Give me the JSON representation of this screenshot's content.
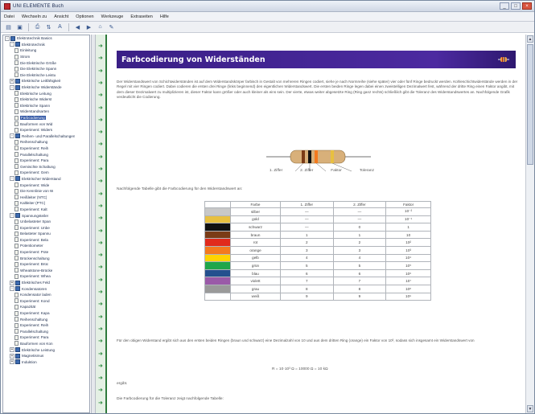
{
  "window": {
    "title": "UNI ELEMENTE Buch"
  },
  "menu": [
    "Datei",
    "Wechseln zu",
    "Ansicht",
    "Optionen",
    "Werkzeuge",
    "Extraseiten",
    "Hilfe"
  ],
  "toolbar": {
    "buttons": [
      "hide-icon",
      "save-icon",
      "print-icon",
      "sync-icon",
      "font-icon",
      "back-icon",
      "forward-icon",
      "home-icon",
      "options-icon"
    ]
  },
  "tree": {
    "items": [
      {
        "label": "Elektrotechnik Basics",
        "level": 0,
        "kind": "book",
        "toggle": "-"
      },
      {
        "label": "Elektrotechnik",
        "level": 1,
        "kind": "book",
        "toggle": "-"
      },
      {
        "label": "Einleitung",
        "level": 2,
        "kind": "doc"
      },
      {
        "label": "Strom",
        "level": 2,
        "kind": "doc"
      },
      {
        "label": "Die Elektrische Größe",
        "level": 2,
        "kind": "doc"
      },
      {
        "label": "Die Elektrische Spann",
        "level": 2,
        "kind": "doc"
      },
      {
        "label": "Die Elektrische Leistu",
        "level": 2,
        "kind": "doc"
      },
      {
        "label": "Elektrische Leitfähigkeit",
        "level": 1,
        "kind": "book",
        "toggle": "+"
      },
      {
        "label": "Elektrische Widerstände",
        "level": 1,
        "kind": "book",
        "toggle": "-"
      },
      {
        "label": "Elektrische Leitung",
        "level": 2,
        "kind": "doc"
      },
      {
        "label": "Elektrische Widerst",
        "level": 2,
        "kind": "doc"
      },
      {
        "label": "Elektrische Spann",
        "level": 2,
        "kind": "doc"
      },
      {
        "label": "Widerstandsarten",
        "level": 2,
        "kind": "doc"
      },
      {
        "label": "Farbcodierung",
        "level": 2,
        "kind": "doc",
        "selected": true
      },
      {
        "label": "Bauformen von Wid",
        "level": 2,
        "kind": "doc"
      },
      {
        "label": "Experiment: Widers",
        "level": 2,
        "kind": "doc"
      },
      {
        "label": "Reihen- und Parallelschaltungen",
        "level": 1,
        "kind": "book",
        "toggle": "-"
      },
      {
        "label": "Reihenschaltung",
        "level": 2,
        "kind": "doc"
      },
      {
        "label": "Experiment: Reih",
        "level": 2,
        "kind": "doc"
      },
      {
        "label": "Parallelschaltung",
        "level": 2,
        "kind": "doc"
      },
      {
        "label": "Experiment: Para",
        "level": 2,
        "kind": "doc"
      },
      {
        "label": "Gemischte Schaltung",
        "level": 2,
        "kind": "doc"
      },
      {
        "label": "Experiment: Gem",
        "level": 2,
        "kind": "doc"
      },
      {
        "label": "Elektrischer Widerstand",
        "level": 1,
        "kind": "book",
        "toggle": "-"
      },
      {
        "label": "Experiment: Wide",
        "level": 2,
        "kind": "doc"
      },
      {
        "label": "Die Kennlinie von W",
        "level": 2,
        "kind": "doc"
      },
      {
        "label": "Heißleiter (NTC)",
        "level": 2,
        "kind": "doc"
      },
      {
        "label": "Kaltleiter (PTC)",
        "level": 2,
        "kind": "doc"
      },
      {
        "label": "Experiment: Kalt",
        "level": 2,
        "kind": "doc"
      },
      {
        "label": "Spannungsteiler",
        "level": 1,
        "kind": "book",
        "toggle": "-"
      },
      {
        "label": "Unbelasteter Span",
        "level": 2,
        "kind": "doc"
      },
      {
        "label": "Experiment: Unbe",
        "level": 2,
        "kind": "doc"
      },
      {
        "label": "Belasteter Spannu",
        "level": 2,
        "kind": "doc"
      },
      {
        "label": "Experiment: Bela",
        "level": 2,
        "kind": "doc"
      },
      {
        "label": "Potentiometer",
        "level": 2,
        "kind": "doc"
      },
      {
        "label": "Experiment: Pote",
        "level": 2,
        "kind": "doc"
      },
      {
        "label": "Brückenschaltung",
        "level": 2,
        "kind": "doc"
      },
      {
        "label": "Experiment: Brüc",
        "level": 2,
        "kind": "doc"
      },
      {
        "label": "Wheatstone-Brücke",
        "level": 2,
        "kind": "doc"
      },
      {
        "label": "Experiment: Whea",
        "level": 2,
        "kind": "doc"
      },
      {
        "label": "Elektrisches Feld",
        "level": 1,
        "kind": "book",
        "toggle": "+"
      },
      {
        "label": "Kondensatoren",
        "level": 1,
        "kind": "book",
        "toggle": "-"
      },
      {
        "label": "Kondensator laden",
        "level": 2,
        "kind": "doc"
      },
      {
        "label": "Experiment: Kond",
        "level": 2,
        "kind": "doc"
      },
      {
        "label": "Kapazität",
        "level": 2,
        "kind": "doc"
      },
      {
        "label": "Experiment: Kapa",
        "level": 2,
        "kind": "doc"
      },
      {
        "label": "Reihenschaltung",
        "level": 2,
        "kind": "doc"
      },
      {
        "label": "Experiment: Reih",
        "level": 2,
        "kind": "doc"
      },
      {
        "label": "Parallelschaltung",
        "level": 2,
        "kind": "doc"
      },
      {
        "label": "Experiment: Para",
        "level": 2,
        "kind": "doc"
      },
      {
        "label": "Bauformen von Kon",
        "level": 2,
        "kind": "doc"
      },
      {
        "label": "Elektrische Leistung",
        "level": 1,
        "kind": "book",
        "toggle": "+"
      },
      {
        "label": "Magnetismus",
        "level": 1,
        "kind": "book",
        "toggle": "+"
      },
      {
        "label": "Induktion",
        "level": 1,
        "kind": "book",
        "toggle": "+"
      }
    ]
  },
  "page": {
    "title": "Farbcodierung von Widerständen",
    "intro": "Der Widerstandswert von Schichtwiderständen ist auf dem Widerstandskörper farbisch in Gestalt von mehreren Ringen codiert, siehe je nach Normreihe (siehe später) vier oder fünf Ringe bedruckt werden. Kohleschichtwiderstände werden in der Regel mit vier Ringen codiert. Dabei codieren die ersten drei Ringe (links beginnend) den eigentlichen Widerstandswert. Die ersten beiden Ringe legen dabei einen zweistelligen Dezimalwert fest, während der dritte Ring einen Faktor angibt, mit dem dieser Dezimalwert zu multiplizieren ist, dieser Faktor kann größer oder auch kleiner als eins sein. Der vierte, etwas weiter abgesetzte Ring (Ring ganz rechts) schließlich gibt die Toleranz des Widerstandswertes an. Nachfolgende Grafik verdeutlicht die Codierung.",
    "resistor_labels": [
      "1. Ziffer",
      "2. Ziffer",
      "Faktor",
      "Toleranz"
    ],
    "table_caption": "Nachfolgende Tabelle gibt die Farbcodierung für den Widerstandswert an:",
    "after_table": "Für den obigen Widerstand ergibt sich aus den ersten beiden Ringen (braun und schwarz) eine Dezimalzahl von 10 und aus dem dritten Ring (orange) ein Faktor von 10³, sodass sich insgesamt ein Widerstandswert von",
    "formula": "R = 10·10³ Ω = 10000 Ω = 10 kΩ",
    "ergibt": "ergibt.",
    "tolerance_intro": "Die Farbcodierung für die Toleranz zeigt nachfolgende Tabelle:"
  },
  "color_table": {
    "headers": [
      "Farbe",
      "1. Ziffer",
      "2. Ziffer",
      "Faktor"
    ],
    "rows": [
      {
        "swatch": "#c8c8c8",
        "name": "silber",
        "d1": "—",
        "d2": "—",
        "factor": "10⁻²"
      },
      {
        "swatch": "#e8c040",
        "name": "gold",
        "d1": "—",
        "d2": "—",
        "factor": "10⁻¹"
      },
      {
        "swatch": "#111111",
        "name": "schwarz",
        "d1": "—",
        "d2": "0",
        "factor": "1"
      },
      {
        "swatch": "#7a3b16",
        "name": "braun",
        "d1": "1",
        "d2": "1",
        "factor": "10"
      },
      {
        "swatch": "#e12a1c",
        "name": "rot",
        "d1": "2",
        "d2": "2",
        "factor": "10²"
      },
      {
        "swatch": "#f47a1e",
        "name": "orange",
        "d1": "3",
        "d2": "3",
        "factor": "10³"
      },
      {
        "swatch": "#ffd400",
        "name": "gelb",
        "d1": "4",
        "d2": "4",
        "factor": "10⁴"
      },
      {
        "swatch": "#1fa64a",
        "name": "grün",
        "d1": "5",
        "d2": "5",
        "factor": "10⁵"
      },
      {
        "swatch": "#24508e",
        "name": "blau",
        "d1": "6",
        "d2": "6",
        "factor": "10⁶"
      },
      {
        "swatch": "#9a5aa8",
        "name": "violett",
        "d1": "7",
        "d2": "7",
        "factor": "10⁷"
      },
      {
        "swatch": "#9a9a9a",
        "name": "grau",
        "d1": "8",
        "d2": "8",
        "factor": "10⁸"
      },
      {
        "swatch": "#ffffff",
        "name": "weiß",
        "d1": "9",
        "d2": "9",
        "factor": "10⁹"
      }
    ]
  },
  "colors": {
    "banner": "#3d2390",
    "selection": "#2f55a4",
    "linkstrip": "#2e7a3c"
  }
}
